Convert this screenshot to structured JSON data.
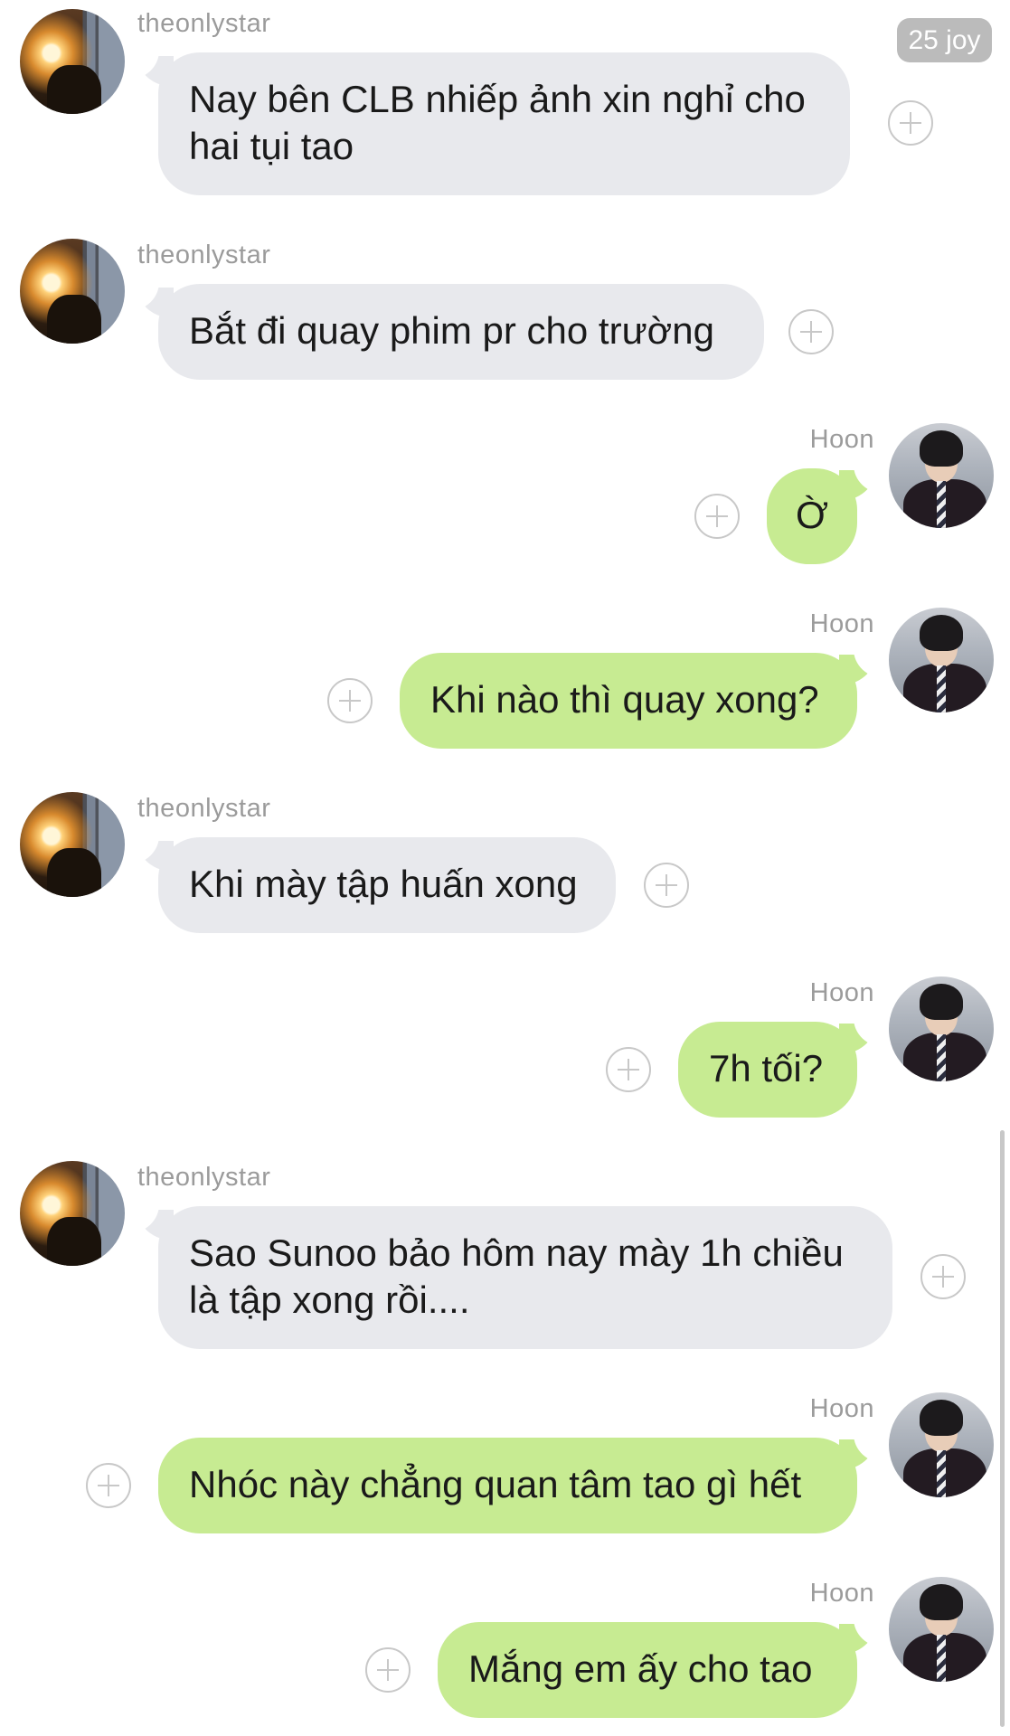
{
  "chat": {
    "badge_text": "25 joy",
    "participants": {
      "other": "theonlystar",
      "me": "Hoon"
    },
    "messages": [
      {
        "sender": "theonlystar",
        "direction": "incoming",
        "text": "Nay bên CLB nhiếp ảnh xin nghỉ cho\nhai tụi tao"
      },
      {
        "sender": "theonlystar",
        "direction": "incoming",
        "text": "Bắt đi quay phim pr cho trường"
      },
      {
        "sender": "Hoon",
        "direction": "outgoing",
        "text": "Ờ"
      },
      {
        "sender": "Hoon",
        "direction": "outgoing",
        "text": "Khi nào thì quay xong?"
      },
      {
        "sender": "theonlystar",
        "direction": "incoming",
        "text": "Khi mày tập huấn xong"
      },
      {
        "sender": "Hoon",
        "direction": "outgoing",
        "text": "7h tối?"
      },
      {
        "sender": "theonlystar",
        "direction": "incoming",
        "text": "Sao Sunoo bảo hôm nay mày 1h chiều\nlà tập xong rồi...."
      },
      {
        "sender": "Hoon",
        "direction": "outgoing",
        "text": "Nhóc này chẳng quan tâm tao gì hết"
      },
      {
        "sender": "Hoon",
        "direction": "outgoing",
        "text": "Mắng em ấy cho tao"
      }
    ]
  }
}
